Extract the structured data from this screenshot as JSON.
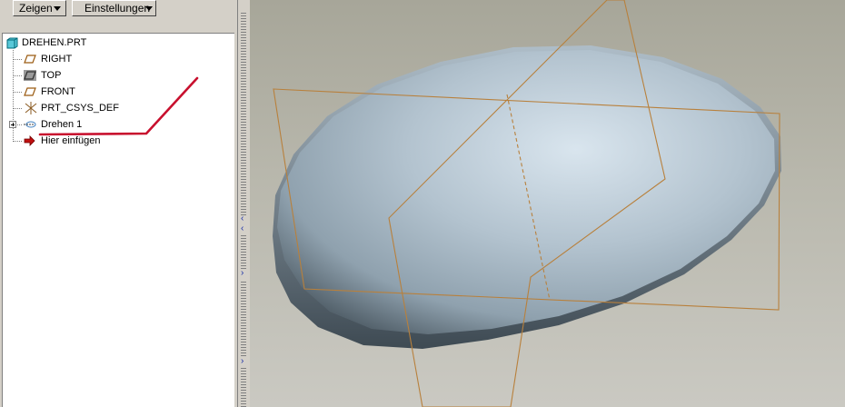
{
  "toolbar": {
    "show_label": "Zeigen",
    "settings_label": "Einstellungen"
  },
  "model_tree": {
    "root": {
      "label": "DREHEN.PRT",
      "icon": "part-icon"
    },
    "items": [
      {
        "label": "RIGHT",
        "icon": "datum-plane-icon"
      },
      {
        "label": "TOP",
        "icon": "datum-plane-icon"
      },
      {
        "label": "FRONT",
        "icon": "datum-plane-icon"
      },
      {
        "label": "PRT_CSYS_DEF",
        "icon": "coordinate-system-icon"
      },
      {
        "label": "Drehen 1",
        "icon": "revolve-feature-icon"
      },
      {
        "label": "Hier einfügen",
        "icon": "insert-here-arrow-icon"
      }
    ]
  },
  "colors": {
    "datum_plane": "#b8803c",
    "annotation_line": "#c8102e",
    "body_light": "#d6e2ea",
    "body_dark": "#4a5a66",
    "splitter_arrow": "#1a2ea8"
  }
}
